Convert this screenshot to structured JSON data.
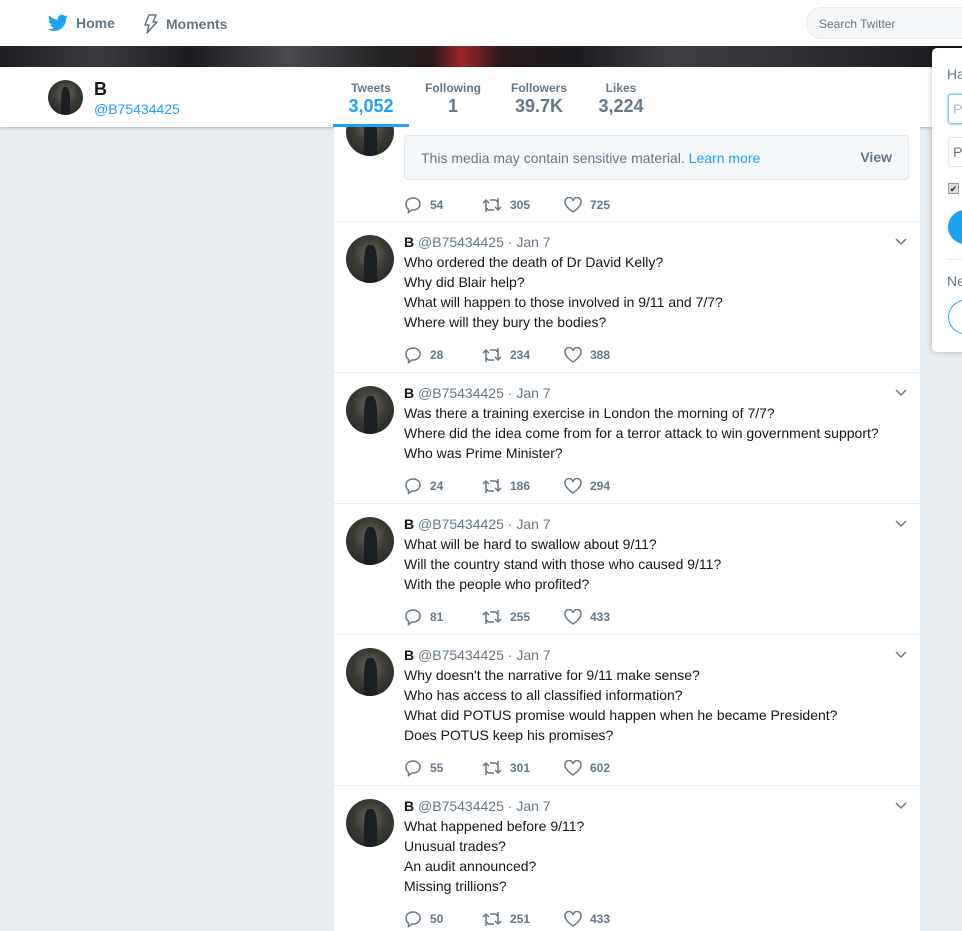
{
  "nav": {
    "home": "Home",
    "moments": "Moments",
    "search_placeholder": "Search Twitter"
  },
  "profile": {
    "name": "B",
    "handle": "@B75434425",
    "stats": [
      {
        "label": "Tweets",
        "value": "3,052",
        "active": true
      },
      {
        "label": "Following",
        "value": "1"
      },
      {
        "label": "Followers",
        "value": "39.7K"
      },
      {
        "label": "Likes",
        "value": "3,224"
      }
    ]
  },
  "first_tweet": {
    "sensitive_text": "This media may contain sensitive material.",
    "learn_more": "Learn more",
    "view": "View",
    "replies": "54",
    "retweets": "305",
    "likes": "725"
  },
  "tweets": [
    {
      "name": "B",
      "handle": "@B75434425",
      "date": "Jan 7",
      "lines": [
        "Who ordered the death of Dr David Kelly?",
        "Why did Blair help?",
        "What will happen to those involved in 9/11 and 7/7?",
        "Where will they bury the bodies?"
      ],
      "replies": "28",
      "retweets": "234",
      "likes": "388"
    },
    {
      "name": "B",
      "handle": "@B75434425",
      "date": "Jan 7",
      "lines": [
        "Was there a training exercise in London the morning of 7/7?",
        "Where did the idea come from for a terror attack to win government support?",
        "Who was Prime Minister?"
      ],
      "replies": "24",
      "retweets": "186",
      "likes": "294"
    },
    {
      "name": "B",
      "handle": "@B75434425",
      "date": "Jan 7",
      "lines": [
        "What will be hard to swallow about 9/11?",
        "Will the country stand with those who caused 9/11?",
        "With the people who profited?"
      ],
      "replies": "81",
      "retweets": "255",
      "likes": "433"
    },
    {
      "name": "B",
      "handle": "@B75434425",
      "date": "Jan 7",
      "lines": [
        "Why doesn't the narrative for 9/11 make sense?",
        "Who has access to all classified information?",
        "What did POTUS promise would happen when he became President?",
        "Does POTUS keep his promises?"
      ],
      "replies": "55",
      "retweets": "301",
      "likes": "602"
    },
    {
      "name": "B",
      "handle": "@B75434425",
      "date": "Jan 7",
      "lines": [
        "What happened before 9/11?",
        "Unusual trades?",
        "An audit announced?",
        "Missing trillions?"
      ],
      "replies": "50",
      "retweets": "251",
      "likes": "433"
    }
  ],
  "signin_panel": {
    "heading": "Ha",
    "phone_placeholder": "Pl",
    "password_placeholder": "Pa",
    "new_heading": "Ne"
  },
  "colors": {
    "accent": "#1da1f2",
    "background": "#e6ecf0",
    "muted": "#657786"
  }
}
